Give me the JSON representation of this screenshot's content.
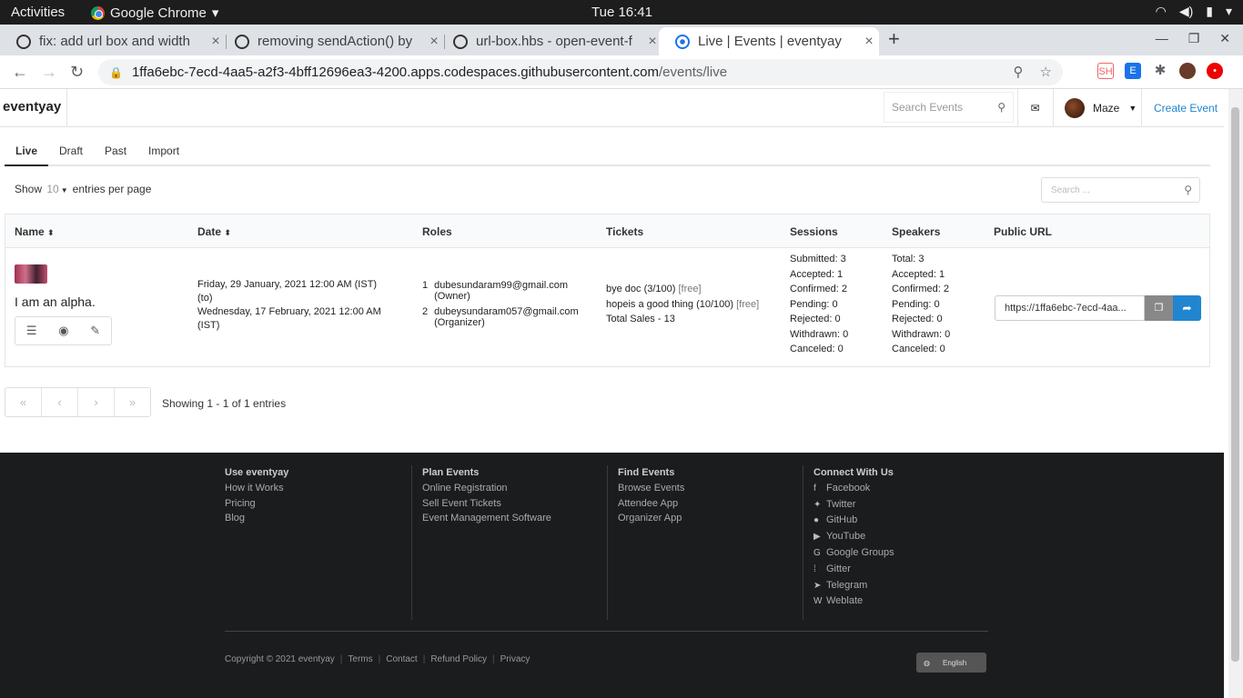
{
  "os": {
    "activities": "Activities",
    "app": "Google Chrome",
    "clock": "Tue 16:41"
  },
  "browser": {
    "tabs": [
      {
        "title": "fix: add url box and width"
      },
      {
        "title": "removing sendAction() by"
      },
      {
        "title": "url-box.hbs - open-event-f"
      },
      {
        "title": "Live | Events | eventyay"
      }
    ],
    "url_host": "1ffa6ebc-7ecd-4aa5-a2f3-4bff12696ea3-4200.apps.codespaces.githubusercontent.com",
    "url_path": "/events/live"
  },
  "nav": {
    "brand": "eventyay",
    "search_placeholder": "Search Events",
    "user": "Maze",
    "create": "Create Event"
  },
  "tabs": [
    "Live",
    "Draft",
    "Past",
    "Import"
  ],
  "table_controls": {
    "show": "Show",
    "entries": "10",
    "per_page": "entries per page",
    "search_placeholder": "Search ..."
  },
  "columns": [
    "Name",
    "Date",
    "Roles",
    "Tickets",
    "Sessions",
    "Speakers",
    "Public URL"
  ],
  "row": {
    "name": "I am an alpha.",
    "date": [
      "Friday, 29 January, 2021 12:00 AM (IST)",
      "(to)",
      "Wednesday, 17 February, 2021 12:00 AM",
      "(IST)"
    ],
    "roles": [
      {
        "n": "1",
        "email": "dubesundaram99@gmail.com",
        "role": "(Owner)"
      },
      {
        "n": "2",
        "email": "dubeysundaram057@gmail.com",
        "role": "(Organizer)"
      }
    ],
    "tickets": [
      {
        "name": "bye doc (3/100)",
        "tag": "[free]"
      },
      {
        "name": "hopeis a good thing (10/100)",
        "tag": "[free]"
      }
    ],
    "total_sales": "Total Sales - 13",
    "sessions": [
      "Submitted: 3",
      "Accepted: 1",
      "Confirmed: 2",
      "Pending: 0",
      "Rejected: 0",
      "Withdrawn: 0",
      "Canceled: 0"
    ],
    "speakers": [
      "Total: 3",
      "Accepted: 1",
      "Confirmed: 2",
      "Pending: 0",
      "Rejected: 0",
      "Withdrawn: 0",
      "Canceled: 0"
    ],
    "public_url": "https://1ffa6ebc-7ecd-4aa..."
  },
  "pager": {
    "first": "«",
    "prev": "‹",
    "next": "›",
    "last": "»"
  },
  "showing": "Showing 1 - 1 of 1 entries",
  "footer": {
    "cols": [
      {
        "title": "Use eventyay",
        "items": [
          "How it Works",
          "Pricing",
          "Blog"
        ]
      },
      {
        "title": "Plan Events",
        "items": [
          "Online Registration",
          "Sell Event Tickets",
          "Event Management Software"
        ]
      },
      {
        "title": "Find Events",
        "items": [
          "Browse Events",
          "Attendee App",
          "Organizer App"
        ]
      },
      {
        "title": "Connect With Us",
        "items": [
          "Facebook",
          "Twitter",
          "GitHub",
          "YouTube",
          "Google Groups",
          "Gitter",
          "Telegram",
          "Weblate"
        ]
      }
    ],
    "copyright": "Copyright © 2021 eventyay",
    "links": [
      "Terms",
      "Contact",
      "Refund Policy",
      "Privacy"
    ],
    "language": "English"
  }
}
